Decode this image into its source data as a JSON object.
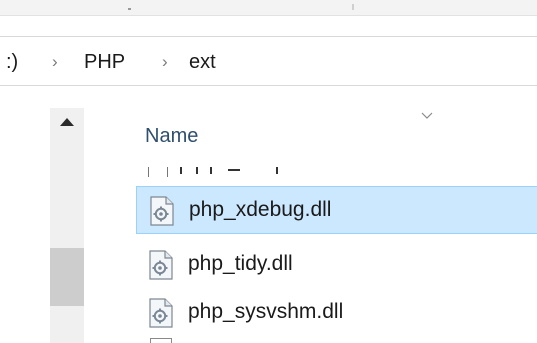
{
  "breadcrumb": {
    "drive": ":)",
    "separator": "›",
    "folder": "PHP",
    "subfolder": "ext"
  },
  "column_header": {
    "name_label": "Name",
    "sort_icon": "chevron-down-icon"
  },
  "files": [
    {
      "name": "php_xdebug.dll",
      "icon": "dll-file-icon",
      "selected": true
    },
    {
      "name": "php_tidy.dll",
      "icon": "dll-file-icon",
      "selected": false
    },
    {
      "name": "php_sysvshm.dll",
      "icon": "dll-file-icon",
      "selected": false
    }
  ],
  "colors": {
    "selection_fill": "#cce8ff",
    "selection_border": "#99d1ff",
    "header_text": "#2f4f6f"
  }
}
